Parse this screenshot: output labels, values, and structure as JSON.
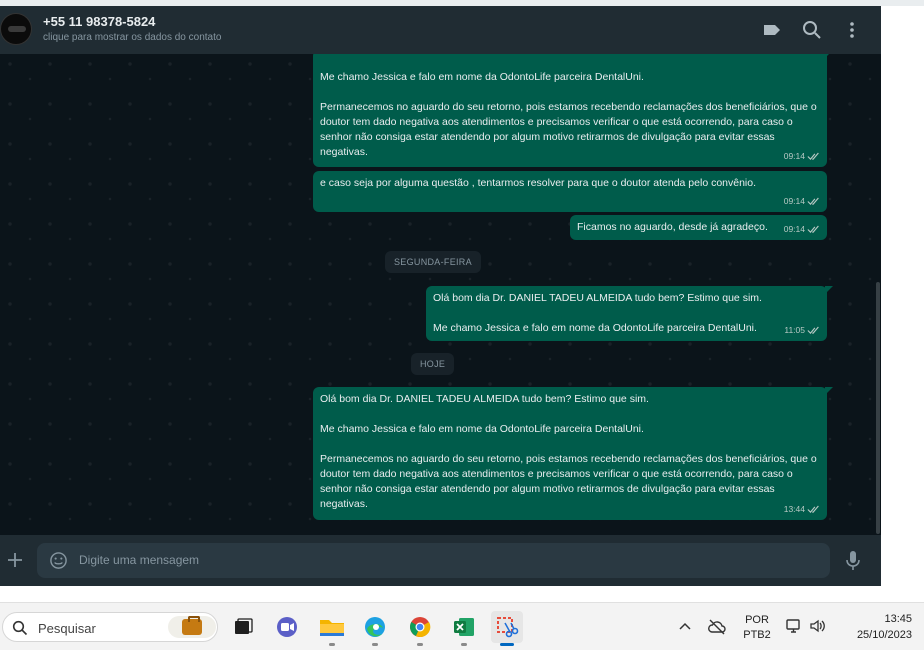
{
  "header": {
    "contact_name": "+55 11 98378-5824",
    "contact_subtitle": "clique para mostrar os dados do contato"
  },
  "messages": [
    {
      "text": "Me chamo Jessica e falo em nome da OdontoLife parceira DentalUni.\n\nPermanecemos no aguardo do seu retorno, pois estamos recebendo reclamações dos beneficiários, que o doutor tem dado negativa aos atendimentos e precisamos verificar o que está ocorrendo, para caso o senhor não consiga estar atendendo por algum motivo retirarmos de divulgação para evitar essas negativas.",
      "time": "09:14"
    },
    {
      "text": "e caso seja por alguma questão , tentarmos resolver para que o doutor atenda pelo convênio.",
      "time": "09:14"
    },
    {
      "text": "Ficamos no aguardo, desde já agradeço.",
      "time": "09:14"
    },
    {
      "text": "Olá bom dia Dr. DANIEL TADEU ALMEIDA tudo bem? Estimo que sim.\n\nMe chamo Jessica e falo em nome da OdontoLife parceira DentalUni.",
      "time": "11:05"
    },
    {
      "text": "Olá bom dia Dr. DANIEL TADEU ALMEIDA tudo bem? Estimo que sim.\n\nMe chamo Jessica e falo em nome da OdontoLife parceira DentalUni.\n\nPermanecemos no aguardo do seu retorno, pois estamos recebendo reclamações dos beneficiários, que o doutor tem dado negativa aos atendimentos e precisamos verificar o que está ocorrendo, para caso o senhor não consiga estar atendendo por algum motivo retirarmos de divulgação para evitar essas negativas.",
      "time": "13:44"
    }
  ],
  "date_separators": [
    "SEGUNDA-FEIRA",
    "HOJE"
  ],
  "composer": {
    "placeholder": "Digite uma mensagem"
  },
  "taskbar": {
    "search_placeholder": "Pesquisar",
    "language_line1": "POR",
    "language_line2": "PTB2",
    "time": "13:45",
    "date": "25/10/2023"
  },
  "colors": {
    "outgoing_bubble": "#005c4b",
    "chat_background": "#0b141a",
    "header_background": "#202c33"
  }
}
